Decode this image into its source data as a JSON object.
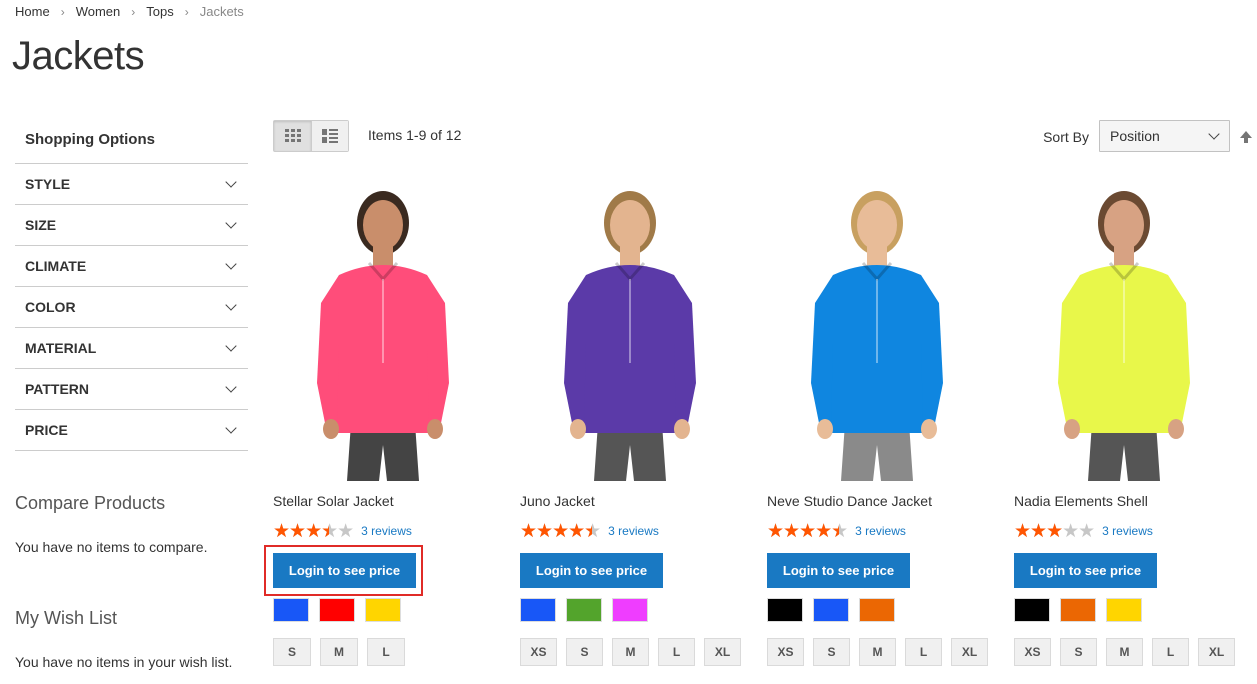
{
  "breadcrumb": {
    "items": [
      "Home",
      "Women",
      "Tops"
    ],
    "current": "Jackets"
  },
  "page_title": "Jackets",
  "sidebar": {
    "title": "Shopping Options",
    "filters": [
      "STYLE",
      "SIZE",
      "CLIMATE",
      "COLOR",
      "MATERIAL",
      "PATTERN",
      "PRICE"
    ]
  },
  "compare": {
    "title": "Compare Products",
    "text": "You have no items to compare."
  },
  "wishlist": {
    "title": "My Wish List",
    "text": "You have no items in your wish list."
  },
  "toolbar": {
    "items_count": "Items 1-9 of 12",
    "sort_label": "Sort By",
    "sort_value": "Position",
    "modes": [
      "grid-icon",
      "list-icon"
    ]
  },
  "products": [
    {
      "name": "Stellar Solar Jacket",
      "rating": 3.5,
      "reviews": "3 reviews",
      "button": "Login to see price",
      "colors": [
        "#1857f7",
        "#ff0000",
        "#ffd500"
      ],
      "sizes": [
        "S",
        "M",
        "L"
      ],
      "garment": "#ff4d7a",
      "pants": "#444"
    },
    {
      "name": "Juno Jacket",
      "rating": 4.5,
      "reviews": "3 reviews",
      "button": "Login to see price",
      "colors": [
        "#1857f7",
        "#53a42c",
        "#ef3dff"
      ],
      "sizes": [
        "XS",
        "S",
        "M",
        "L",
        "XL"
      ],
      "garment": "#5b3aa8",
      "pants": "#555"
    },
    {
      "name": "Neve Studio Dance Jacket",
      "rating": 4.5,
      "reviews": "3 reviews",
      "button": "Login to see price",
      "colors": [
        "#000000",
        "#1857f7",
        "#eb6703"
      ],
      "sizes": [
        "XS",
        "S",
        "M",
        "L",
        "XL"
      ],
      "garment": "#0f86e0",
      "pants": "#8a8a8a"
    },
    {
      "name": "Nadia Elements Shell",
      "rating": 3,
      "reviews": "3 reviews",
      "button": "Login to see price",
      "colors": [
        "#000000",
        "#eb6703",
        "#ffd500"
      ],
      "sizes": [
        "XS",
        "S",
        "M",
        "L",
        "XL"
      ],
      "garment": "#e8f74a",
      "pants": "#555"
    }
  ]
}
